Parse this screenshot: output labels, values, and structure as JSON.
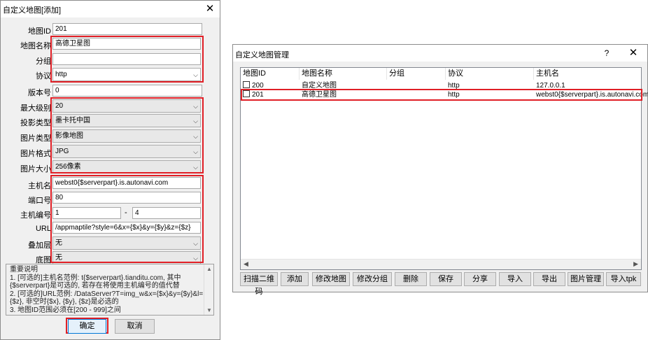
{
  "left_dialog": {
    "title": "自定义地图[添加]",
    "fields": {
      "map_id": {
        "label": "地图ID",
        "value": "201"
      },
      "map_name": {
        "label": "地图名称",
        "value": "高德卫星图"
      },
      "group": {
        "label": "分组",
        "value": ""
      },
      "protocol": {
        "label": "协议",
        "value": "http"
      },
      "version": {
        "label": "版本号",
        "value": "0"
      },
      "max_level": {
        "label": "最大级别",
        "value": "20"
      },
      "projection": {
        "label": "投影类型",
        "value": "墨卡托中国"
      },
      "image_type": {
        "label": "图片类型",
        "value": "影像地图"
      },
      "image_format": {
        "label": "图片格式",
        "value": "JPG"
      },
      "image_size": {
        "label": "图片大小",
        "value": "256像素"
      },
      "host": {
        "label": "主机名",
        "value": "webst0{$serverpart}.is.autonavi.com"
      },
      "port": {
        "label": "端口号",
        "value": "80"
      },
      "host_no": {
        "label": "主机编号",
        "from": "1",
        "sep": "-",
        "to": "4"
      },
      "url": {
        "label": "URL",
        "value": "/appmaptile?style=6&x={$x}&y={$y}&z={$z}"
      },
      "overlay": {
        "label": "叠加层",
        "value": "无"
      },
      "base": {
        "label": "底图",
        "value": "无"
      }
    },
    "notes": [
      "重要说明",
      "1. [可选的]主机名范例: t{$serverpart}.tianditu.com, 其中",
      "{$serverpart}是可选的, 若存在将使用主机编号的值代替",
      "2. [可选的]URL范例: /DataServer?T=img_w&x={$x}&y={$y}&l=",
      "{$z}, 非空时{$x}, {$y}, {$z}是必选的",
      "3. 地图ID范围必须在[200 - 999]之间"
    ],
    "ok_label": "确定",
    "cancel_label": "取消"
  },
  "right_dialog": {
    "title": "自定义地图管理",
    "help": "?",
    "columns": [
      "地图ID",
      "地图名称",
      "分组",
      "协议",
      "主机名"
    ],
    "rows": [
      {
        "id": "200",
        "name": "自定义地图",
        "group": "",
        "protocol": "http",
        "host": "127.0.0.1"
      },
      {
        "id": "201",
        "name": "高德卫星图",
        "group": "",
        "protocol": "http",
        "host": "webst0{$serverpart}.is.autonavi.com"
      }
    ],
    "buttons": [
      "扫描二维码",
      "添加",
      "修改地图",
      "修改分组",
      "删除",
      "保存",
      "分享",
      "导入",
      "导出",
      "图片管理",
      "导入tpk"
    ]
  },
  "colors": {
    "highlight": "#e01f26",
    "ok_focus": "#0078d7"
  }
}
